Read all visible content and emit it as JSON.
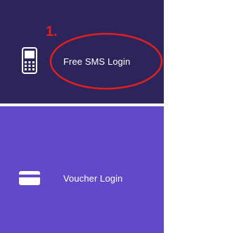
{
  "colors": {
    "sms_tile": "#2c245a",
    "voucher_tile": "#6249c9",
    "annotation": "#e0201f",
    "text": "#ffffff"
  },
  "tiles": [
    {
      "label": "Free SMS Login",
      "icon": "mobile-phone-icon"
    },
    {
      "label": "Voucher Login",
      "icon": "card-icon"
    }
  ],
  "annotation": {
    "label": "1."
  }
}
